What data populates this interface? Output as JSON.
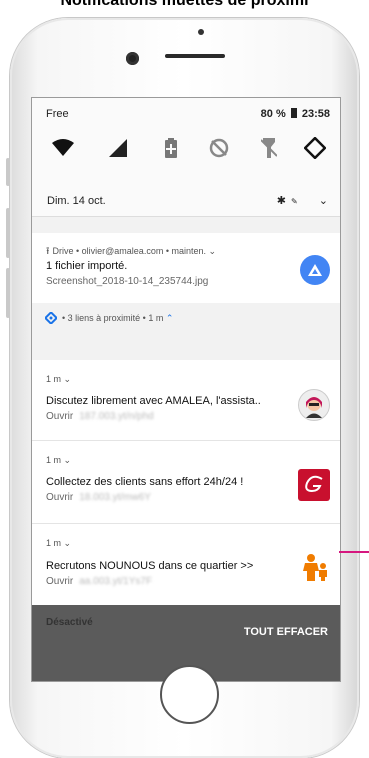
{
  "page_heading": "Notifications muettes de proximi",
  "status_bar": {
    "carrier": "Free",
    "battery_percent": "80 %",
    "time": "23:58"
  },
  "quick_settings": {
    "date": "Dim. 14 oct.",
    "icons": [
      "wifi-icon",
      "signal-icon",
      "battery-saver-icon",
      "dnd-off-icon",
      "flashlight-off-icon",
      "auto-rotate-icon"
    ]
  },
  "notifications": {
    "drive": {
      "meta": "Drive • olivier@amalea.com • mainten. ⌄",
      "title": "1 fichier importé.",
      "subtitle": "Screenshot_2018-10-14_235744.jpg"
    },
    "nearby_header": "• 3 liens à proximité • 1 m",
    "nearby_chevron": "⌃",
    "items": [
      {
        "meta": "1 m ⌄",
        "title": "Discutez librement avec AMALEA, l'assista..",
        "action": "Ouvrir",
        "blurred": "187.003.yt/n/phd"
      },
      {
        "meta": "1 m ⌄",
        "title": "Collectez des clients sans effort 24h/24 !",
        "action": "Ouvrir",
        "blurred": "18.003.yt/mw6Y"
      },
      {
        "meta": "1 m ⌄",
        "title": "Recrutons NOUNOUS dans ce quartier >>",
        "action": "Ouvrir",
        "blurred": "aa.003.yt/1Ys7F"
      }
    ]
  },
  "bottom": {
    "disabled_label": "Désactivé",
    "clear_all": "TOUT EFFACER"
  },
  "colors": {
    "drive_blue": "#4285f4",
    "nearby_blue": "#1a73e8",
    "brand_red": "#c8102e",
    "nanny_orange": "#f07c00",
    "arrow_pink": "#d6177f"
  }
}
